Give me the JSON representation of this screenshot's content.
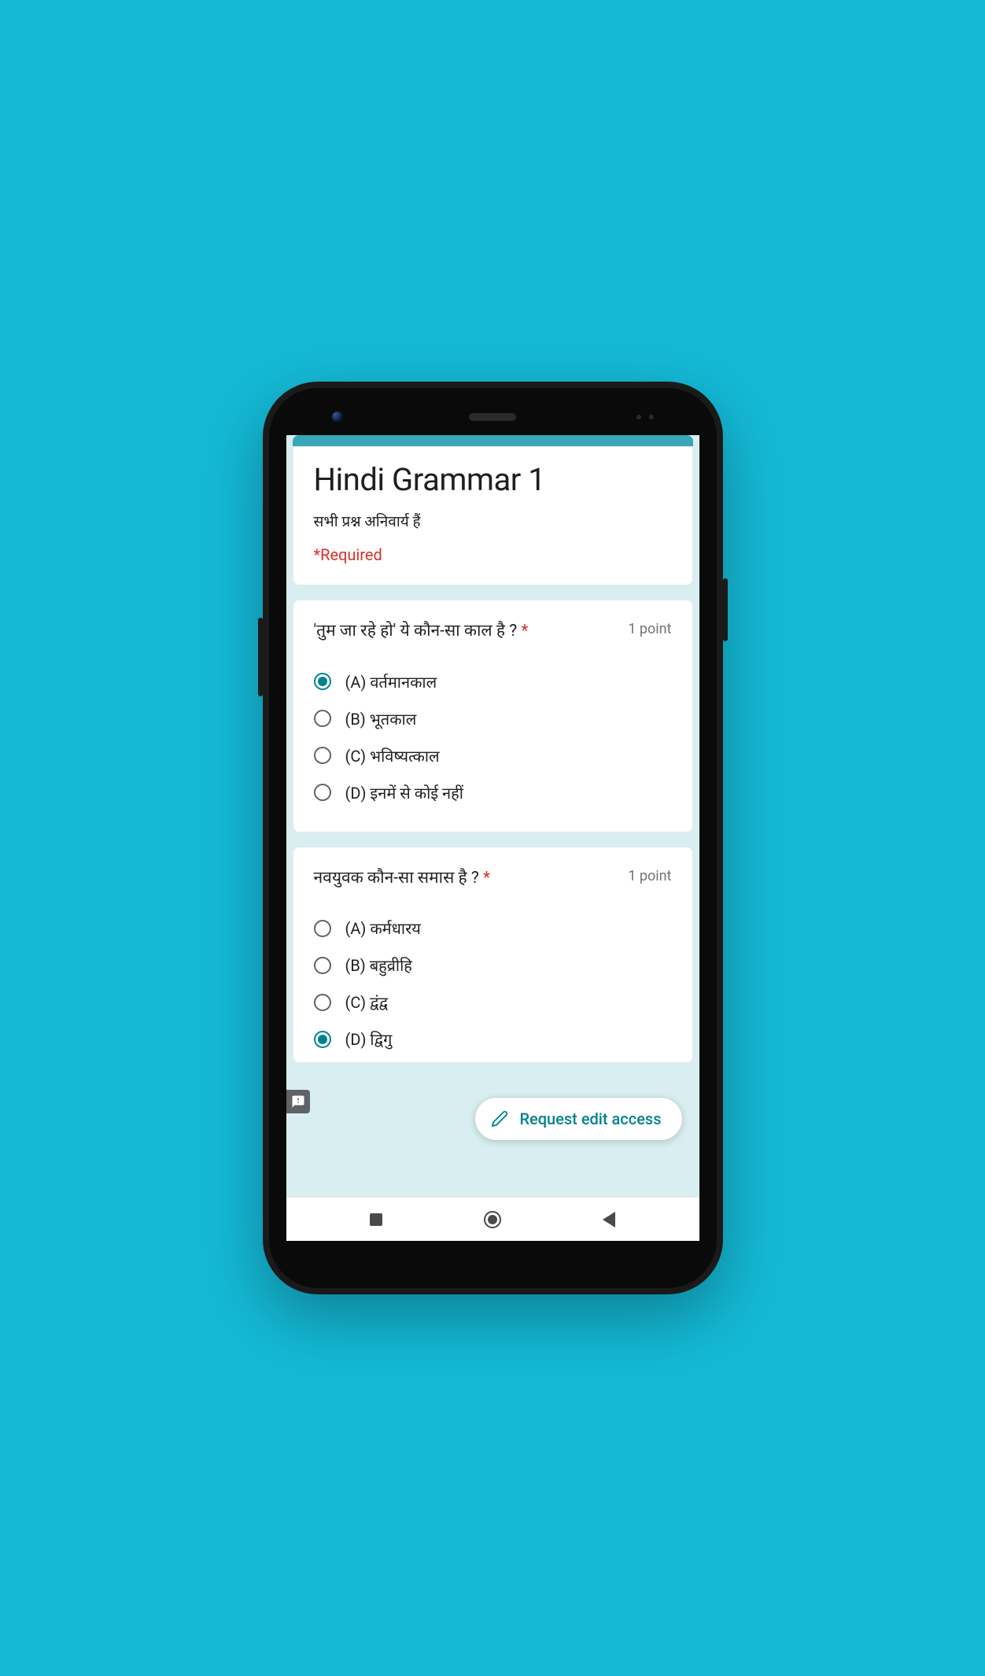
{
  "colors": {
    "background": "#14b9d6",
    "accent": "#00838f",
    "required": "#d93025"
  },
  "form": {
    "title": "Hindi Grammar 1",
    "description": "सभी प्रश्न अनिवार्य हैं",
    "required_label": "*Required"
  },
  "questions": [
    {
      "text": "'तुम जा रहे हो' ये कौन-सा काल है ?",
      "points": "1 point",
      "required": true,
      "selected_index": 0,
      "options": [
        "(A) वर्तमानकाल",
        "(B) भूतकाल",
        "(C) भविष्यत्काल",
        "(D) इनमें से कोई नहीं"
      ]
    },
    {
      "text": "नवयुवक कौन-सा समास है ?",
      "points": "1 point",
      "required": true,
      "selected_index": 3,
      "options": [
        "(A) कर्मधारय",
        "(B) बहुव्रीहि",
        "(C) द्वंद्व",
        "(D) द्विगु"
      ]
    }
  ],
  "fab": {
    "label": "Request edit access"
  },
  "nav": {
    "recent": "recent-apps",
    "home": "home",
    "back": "back"
  }
}
